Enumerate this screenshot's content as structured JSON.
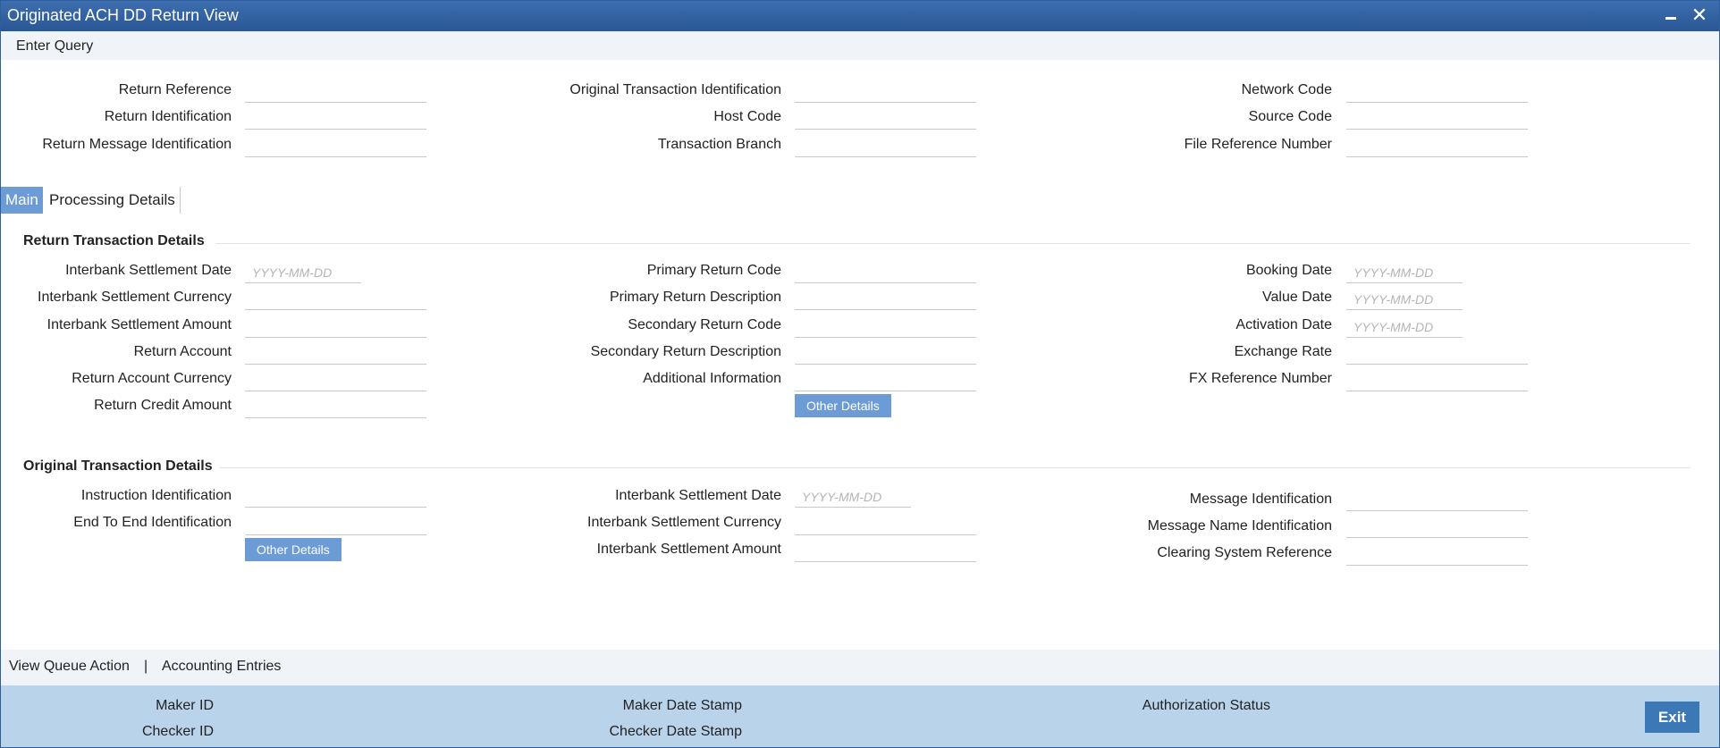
{
  "window": {
    "title": "Originated ACH DD Return View",
    "minimize_icon": "minimize-icon",
    "close_icon": "close-icon",
    "close_glyph": "✕"
  },
  "toolbar": {
    "enter_query": "Enter Query"
  },
  "header_fields": {
    "return_reference": "Return Reference",
    "return_identification": "Return Identification",
    "return_message_identification": "Return Message Identification",
    "original_transaction_identification": "Original Transaction Identification",
    "host_code": "Host Code",
    "transaction_branch": "Transaction Branch",
    "network_code": "Network Code",
    "source_code": "Source Code",
    "file_reference_number": "File Reference Number"
  },
  "tabs": [
    {
      "label": "Main",
      "active": true
    },
    {
      "label": "Processing Details",
      "active": false
    }
  ],
  "return_section": {
    "title": "Return Transaction Details",
    "interbank_settlement_date": "Interbank Settlement Date",
    "interbank_settlement_currency": "Interbank Settlement Currency",
    "interbank_settlement_amount": "Interbank Settlement Amount",
    "return_account": "Return Account",
    "return_account_currency": "Return Account Currency",
    "return_credit_amount": "Return Credit Amount",
    "primary_return_code": "Primary Return Code",
    "primary_return_description": "Primary Return Description",
    "secondary_return_code": "Secondary Return Code",
    "secondary_return_description": "Secondary Return Description",
    "additional_information": "Additional Information",
    "other_details_button": "Other Details",
    "booking_date": "Booking Date",
    "value_date": "Value Date",
    "activation_date": "Activation Date",
    "exchange_rate": "Exchange Rate",
    "fx_reference_number": "FX Reference Number"
  },
  "original_section": {
    "title": "Original Transaction Details",
    "instruction_identification": "Instruction Identification",
    "end_to_end_identification": "End To End Identification",
    "other_details_button": "Other Details",
    "interbank_settlement_date": "Interbank Settlement Date",
    "interbank_settlement_currency": "Interbank Settlement Currency",
    "interbank_settlement_amount": "Interbank Settlement Amount",
    "message_identification": "Message Identification",
    "message_name_identification": "Message Name Identification",
    "clearing_system_reference": "Clearing System Reference"
  },
  "date_placeholder": "YYYY-MM-DD",
  "linkbar": {
    "view_queue_action": "View Queue Action",
    "separator": "|",
    "accounting_entries": "Accounting Entries"
  },
  "footer": {
    "maker_id": "Maker ID",
    "checker_id": "Checker ID",
    "maker_date_stamp": "Maker Date Stamp",
    "checker_date_stamp": "Checker Date Stamp",
    "authorization_status": "Authorization Status",
    "exit_button": "Exit"
  }
}
